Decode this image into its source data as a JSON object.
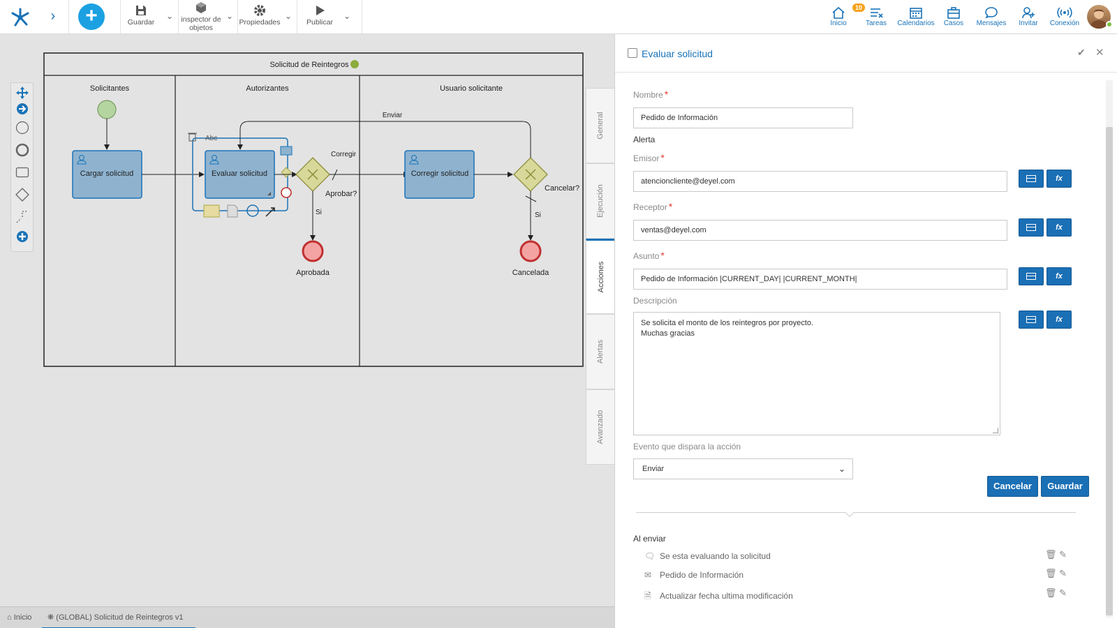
{
  "toolbar": {
    "guardar": "Guardar",
    "inspector_1": "inspector de",
    "inspector_2": "objetos",
    "propiedades": "Propiedades",
    "publicar": "Publicar"
  },
  "nav": {
    "inicio": "Inicio",
    "tareas": "Tareas",
    "tareas_badge": "10",
    "calendarios": "Calendarios",
    "casos": "Casos",
    "mensajes": "Mensajes",
    "invitar": "Invitar",
    "conexion": "Conexión"
  },
  "diagram": {
    "pool_title": "Solicitud de Reintegros",
    "lanes": [
      "Solicitantes",
      "Autorizantes",
      "Usuario solicitante"
    ],
    "tasks": [
      "Cargar solicitud",
      "Evaluar solicitud",
      "Corregir solicitud"
    ],
    "gateway_1": "Aprobar?",
    "gateway_2": "Cancelar?",
    "flow_enviar": "Enviar",
    "flow_corregir": "Corregir",
    "flow_si_1": "Si",
    "flow_si_2": "Si",
    "end_1": "Aprobada",
    "end_2": "Cancelada",
    "text_tool": "Abc"
  },
  "side_tabs": [
    "General",
    "Ejecución",
    "Acciones",
    "Alertas",
    "Avanzado"
  ],
  "panel": {
    "title": "Evaluar solicitud",
    "nombre_label": "Nombre",
    "nombre_value": "Pedido de Información",
    "alerta_label": "Alerta",
    "emisor_label": "Emisor",
    "emisor_value": "atencioncliente@deyel.com",
    "receptor_label": "Receptor",
    "receptor_value": "ventas@deyel.com",
    "asunto_label": "Asunto",
    "asunto_value": "Pedido de Información  |CURRENT_DAY|  |CURRENT_MONTH|",
    "descripcion_label": "Descripción",
    "descripcion_value": "Se solicita el monto de los reintegros por proyecto.\nMuchas gracias",
    "evento_label": "Evento que dispara la acción",
    "evento_value": "Enviar",
    "cancelar": "Cancelar",
    "guardar": "Guardar",
    "fx_label": "fx",
    "al_enviar": "Al enviar",
    "actions": [
      "Se esta evaluando la solicitud",
      "Pedido de Información",
      "Actualizar fecha ultima modificación"
    ]
  },
  "bottom_tabs": {
    "inicio": "Inicio",
    "proceso": "(GLOBAL) Solicitud de Reintegros v1"
  },
  "colors": {
    "brand": "#1a73b8",
    "button": "#1a6fb5",
    "task_fill": "#8fb3cf",
    "gateway_fill": "#d8d89a",
    "start_fill": "#b4d4a0",
    "end_fill": "#f4a3a3",
    "status_dot": "#8bab3c"
  }
}
